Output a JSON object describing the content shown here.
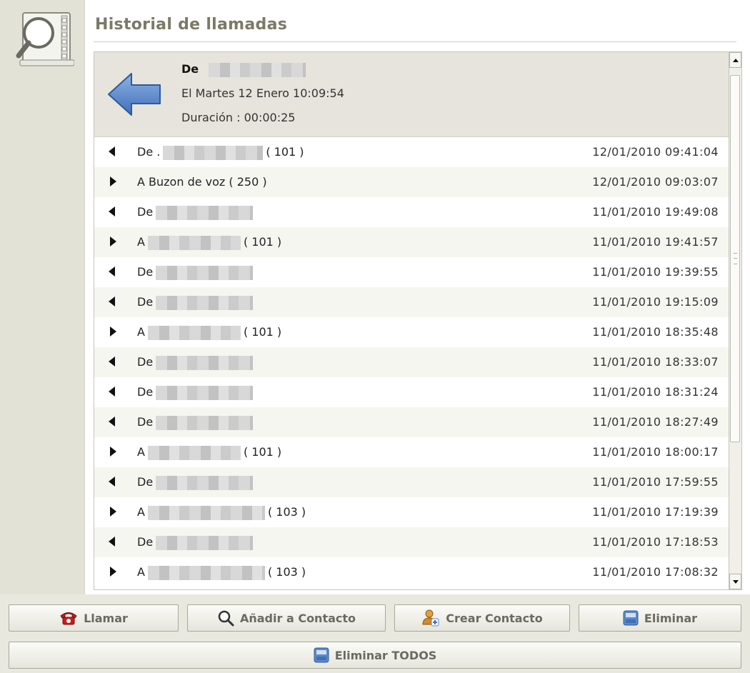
{
  "title": "Historial de llamadas",
  "detail": {
    "name_prefix": "De",
    "date": "El Martes 12 Enero 10:09:54",
    "duration": "Duración : 00:00:25"
  },
  "calls": [
    {
      "direction": "in",
      "prefix": "De .",
      "ext": "( 101 )",
      "time": "12/01/2010 09:41:04"
    },
    {
      "direction": "out",
      "prefix": "A Buzon de voz ( 250 )",
      "ext": "",
      "time": "12/01/2010 09:03:07"
    },
    {
      "direction": "in",
      "prefix": "De",
      "ext": "",
      "time": "11/01/2010 19:49:08"
    },
    {
      "direction": "out",
      "prefix": "A",
      "ext": "( 101 )",
      "time": "11/01/2010 19:41:57"
    },
    {
      "direction": "in",
      "prefix": "De",
      "ext": "",
      "time": "11/01/2010 19:39:55"
    },
    {
      "direction": "in",
      "prefix": "De",
      "ext": "",
      "time": "11/01/2010 19:15:09"
    },
    {
      "direction": "out",
      "prefix": "A",
      "ext": "( 101 )",
      "time": "11/01/2010 18:35:48"
    },
    {
      "direction": "in",
      "prefix": "De",
      "ext": "",
      "time": "11/01/2010 18:33:07"
    },
    {
      "direction": "in",
      "prefix": "De",
      "ext": "",
      "time": "11/01/2010 18:31:24"
    },
    {
      "direction": "in",
      "prefix": "De",
      "ext": "",
      "time": "11/01/2010 18:27:49"
    },
    {
      "direction": "out",
      "prefix": "A",
      "ext": "( 101 )",
      "time": "11/01/2010 18:00:17"
    },
    {
      "direction": "in",
      "prefix": "De",
      "ext": "",
      "time": "11/01/2010 17:59:55"
    },
    {
      "direction": "out",
      "prefix": "A",
      "ext": "( 103 )",
      "time": "11/01/2010 17:19:39"
    },
    {
      "direction": "in",
      "prefix": "De",
      "ext": "",
      "time": "11/01/2010 17:18:53"
    },
    {
      "direction": "out",
      "prefix": "A",
      "ext": "( 103 )",
      "time": "11/01/2010 17:08:32"
    }
  ],
  "buttons": {
    "call": "Llamar",
    "add_contact": "Añadir a Contacto",
    "create_contact": "Crear Contacto",
    "delete": "Eliminar",
    "delete_all": "Eliminar TODOS"
  },
  "colors": {
    "accent_blue": "#5b88c9",
    "call_red": "#c21f1f",
    "title_text": "#7b7a66"
  },
  "icons": {
    "logo": "magnifier-icon",
    "detail_direction": "arrow-left-icon",
    "call": "phone-icon",
    "add_contact": "search-icon",
    "create_contact": "person-add-icon",
    "delete": "disk-icon"
  }
}
